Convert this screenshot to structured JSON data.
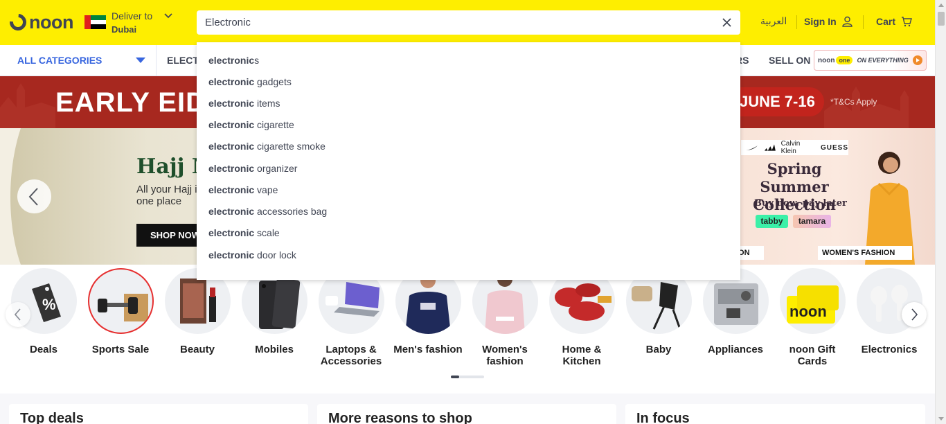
{
  "header": {
    "logo": "noon",
    "deliver_label": "Deliver to",
    "deliver_city": "Dubai",
    "search_value": "Electronic",
    "language": "العربية",
    "signin": "Sign In",
    "cart": "Cart"
  },
  "colors": {
    "header_bg": "#feee00",
    "accent_blue": "#3866df",
    "text": "#404553",
    "eid_red": "#a7281f"
  },
  "nav": {
    "all_categories": "ALL CATEGORIES",
    "item_electronics": "ELECT",
    "item_partial": "RS",
    "item_sell": "SELL ON",
    "promo_noon": "noon",
    "promo_one": "one",
    "promo_tag": "ON EVERYTHING"
  },
  "suggestions": [
    {
      "bold": "electronic",
      "rest": "s"
    },
    {
      "bold": "electronic",
      "rest": " gadgets"
    },
    {
      "bold": "electronic",
      "rest": " items"
    },
    {
      "bold": "electronic",
      "rest": " cigarette"
    },
    {
      "bold": "electronic",
      "rest": " cigarette smoke"
    },
    {
      "bold": "electronic",
      "rest": " organizer"
    },
    {
      "bold": "electronic",
      "rest": " vape"
    },
    {
      "bold": "electronic",
      "rest": " accessories bag"
    },
    {
      "bold": "electronic",
      "rest": " scale"
    },
    {
      "bold": "electronic",
      "rest": " door lock"
    }
  ],
  "banner": {
    "eid_title": "EARLY EID",
    "eid_dates": "JUNE 7-16",
    "eid_terms": "*T&Cs Apply",
    "hajj_title": "Hajj M",
    "hajj_sub": "All your Hajj in one place",
    "shop_now": "SHOP NOW",
    "brand_calvin": "Calvin Klein",
    "brand_guess": "GUESS",
    "fashion_title": "Spring Summer Collection",
    "fashion_sub": "Buy now, pay later",
    "tabby": "tabby",
    "tamara": "tamara",
    "cta_left": "ION",
    "cta_women": "WOMEN'S FASHION"
  },
  "categories": [
    {
      "label": "Deals"
    },
    {
      "label": "Sports Sale"
    },
    {
      "label": "Beauty"
    },
    {
      "label": "Mobiles"
    },
    {
      "label": "Laptops & Accessories"
    },
    {
      "label": "Men's fashion"
    },
    {
      "label": "Women's fashion"
    },
    {
      "label": "Home & Kitchen"
    },
    {
      "label": "Baby"
    },
    {
      "label": "Appliances"
    },
    {
      "label": "noon Gift Cards"
    },
    {
      "label": "Electronics"
    }
  ],
  "cards": {
    "top_deals": "Top deals",
    "more_reasons": "More reasons to shop",
    "in_focus": "In focus"
  }
}
